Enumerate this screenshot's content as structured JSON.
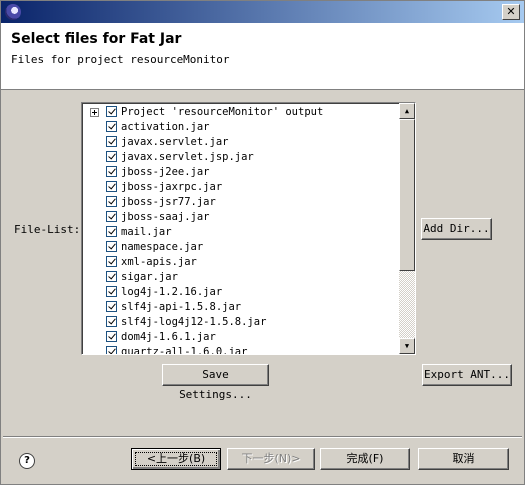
{
  "window": {
    "close_glyph": "✕"
  },
  "header": {
    "title": "Select files for Fat Jar",
    "subtitle": "Files for project resourceMonitor"
  },
  "file_list": {
    "label": "File-List:",
    "items": [
      {
        "label": "Project 'resourceMonitor' output",
        "checked": true,
        "expandable": true
      },
      {
        "label": "activation.jar",
        "checked": true
      },
      {
        "label": "javax.servlet.jar",
        "checked": true
      },
      {
        "label": "javax.servlet.jsp.jar",
        "checked": true
      },
      {
        "label": "jboss-j2ee.jar",
        "checked": true
      },
      {
        "label": "jboss-jaxrpc.jar",
        "checked": true
      },
      {
        "label": "jboss-jsr77.jar",
        "checked": true
      },
      {
        "label": "jboss-saaj.jar",
        "checked": true
      },
      {
        "label": "mail.jar",
        "checked": true
      },
      {
        "label": "namespace.jar",
        "checked": true
      },
      {
        "label": "xml-apis.jar",
        "checked": true
      },
      {
        "label": "sigar.jar",
        "checked": true
      },
      {
        "label": "log4j-1.2.16.jar",
        "checked": true
      },
      {
        "label": "slf4j-api-1.5.8.jar",
        "checked": true
      },
      {
        "label": "slf4j-log4j12-1.5.8.jar",
        "checked": true
      },
      {
        "label": "dom4j-1.6.1.jar",
        "checked": true
      },
      {
        "label": "quartz-all-1.6.0.jar",
        "checked": true
      }
    ]
  },
  "buttons": {
    "add_dir": "Add Dir...",
    "save_settings": "Save Settings...",
    "export_ant": "Export ANT...",
    "back": "<上一步(B)",
    "next": "下一步(N)>",
    "finish": "完成(F)",
    "cancel": "取消"
  },
  "help_glyph": "?"
}
